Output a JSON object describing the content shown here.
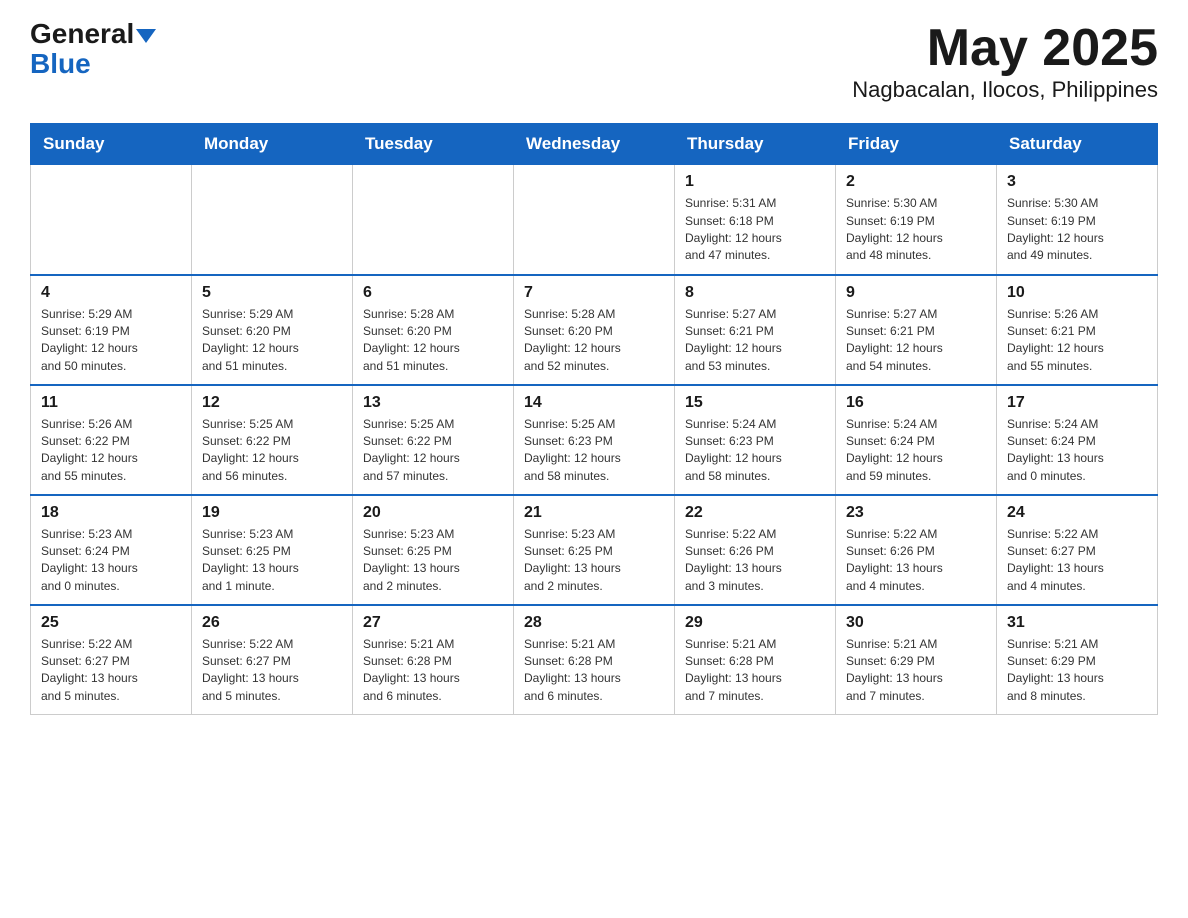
{
  "header": {
    "logo_general": "General",
    "logo_blue": "Blue",
    "month_title": "May 2025",
    "location": "Nagbacalan, Ilocos, Philippines"
  },
  "weekdays": [
    "Sunday",
    "Monday",
    "Tuesday",
    "Wednesday",
    "Thursday",
    "Friday",
    "Saturday"
  ],
  "weeks": [
    [
      {
        "day": "",
        "info": ""
      },
      {
        "day": "",
        "info": ""
      },
      {
        "day": "",
        "info": ""
      },
      {
        "day": "",
        "info": ""
      },
      {
        "day": "1",
        "info": "Sunrise: 5:31 AM\nSunset: 6:18 PM\nDaylight: 12 hours\nand 47 minutes."
      },
      {
        "day": "2",
        "info": "Sunrise: 5:30 AM\nSunset: 6:19 PM\nDaylight: 12 hours\nand 48 minutes."
      },
      {
        "day": "3",
        "info": "Sunrise: 5:30 AM\nSunset: 6:19 PM\nDaylight: 12 hours\nand 49 minutes."
      }
    ],
    [
      {
        "day": "4",
        "info": "Sunrise: 5:29 AM\nSunset: 6:19 PM\nDaylight: 12 hours\nand 50 minutes."
      },
      {
        "day": "5",
        "info": "Sunrise: 5:29 AM\nSunset: 6:20 PM\nDaylight: 12 hours\nand 51 minutes."
      },
      {
        "day": "6",
        "info": "Sunrise: 5:28 AM\nSunset: 6:20 PM\nDaylight: 12 hours\nand 51 minutes."
      },
      {
        "day": "7",
        "info": "Sunrise: 5:28 AM\nSunset: 6:20 PM\nDaylight: 12 hours\nand 52 minutes."
      },
      {
        "day": "8",
        "info": "Sunrise: 5:27 AM\nSunset: 6:21 PM\nDaylight: 12 hours\nand 53 minutes."
      },
      {
        "day": "9",
        "info": "Sunrise: 5:27 AM\nSunset: 6:21 PM\nDaylight: 12 hours\nand 54 minutes."
      },
      {
        "day": "10",
        "info": "Sunrise: 5:26 AM\nSunset: 6:21 PM\nDaylight: 12 hours\nand 55 minutes."
      }
    ],
    [
      {
        "day": "11",
        "info": "Sunrise: 5:26 AM\nSunset: 6:22 PM\nDaylight: 12 hours\nand 55 minutes."
      },
      {
        "day": "12",
        "info": "Sunrise: 5:25 AM\nSunset: 6:22 PM\nDaylight: 12 hours\nand 56 minutes."
      },
      {
        "day": "13",
        "info": "Sunrise: 5:25 AM\nSunset: 6:22 PM\nDaylight: 12 hours\nand 57 minutes."
      },
      {
        "day": "14",
        "info": "Sunrise: 5:25 AM\nSunset: 6:23 PM\nDaylight: 12 hours\nand 58 minutes."
      },
      {
        "day": "15",
        "info": "Sunrise: 5:24 AM\nSunset: 6:23 PM\nDaylight: 12 hours\nand 58 minutes."
      },
      {
        "day": "16",
        "info": "Sunrise: 5:24 AM\nSunset: 6:24 PM\nDaylight: 12 hours\nand 59 minutes."
      },
      {
        "day": "17",
        "info": "Sunrise: 5:24 AM\nSunset: 6:24 PM\nDaylight: 13 hours\nand 0 minutes."
      }
    ],
    [
      {
        "day": "18",
        "info": "Sunrise: 5:23 AM\nSunset: 6:24 PM\nDaylight: 13 hours\nand 0 minutes."
      },
      {
        "day": "19",
        "info": "Sunrise: 5:23 AM\nSunset: 6:25 PM\nDaylight: 13 hours\nand 1 minute."
      },
      {
        "day": "20",
        "info": "Sunrise: 5:23 AM\nSunset: 6:25 PM\nDaylight: 13 hours\nand 2 minutes."
      },
      {
        "day": "21",
        "info": "Sunrise: 5:23 AM\nSunset: 6:25 PM\nDaylight: 13 hours\nand 2 minutes."
      },
      {
        "day": "22",
        "info": "Sunrise: 5:22 AM\nSunset: 6:26 PM\nDaylight: 13 hours\nand 3 minutes."
      },
      {
        "day": "23",
        "info": "Sunrise: 5:22 AM\nSunset: 6:26 PM\nDaylight: 13 hours\nand 4 minutes."
      },
      {
        "day": "24",
        "info": "Sunrise: 5:22 AM\nSunset: 6:27 PM\nDaylight: 13 hours\nand 4 minutes."
      }
    ],
    [
      {
        "day": "25",
        "info": "Sunrise: 5:22 AM\nSunset: 6:27 PM\nDaylight: 13 hours\nand 5 minutes."
      },
      {
        "day": "26",
        "info": "Sunrise: 5:22 AM\nSunset: 6:27 PM\nDaylight: 13 hours\nand 5 minutes."
      },
      {
        "day": "27",
        "info": "Sunrise: 5:21 AM\nSunset: 6:28 PM\nDaylight: 13 hours\nand 6 minutes."
      },
      {
        "day": "28",
        "info": "Sunrise: 5:21 AM\nSunset: 6:28 PM\nDaylight: 13 hours\nand 6 minutes."
      },
      {
        "day": "29",
        "info": "Sunrise: 5:21 AM\nSunset: 6:28 PM\nDaylight: 13 hours\nand 7 minutes."
      },
      {
        "day": "30",
        "info": "Sunrise: 5:21 AM\nSunset: 6:29 PM\nDaylight: 13 hours\nand 7 minutes."
      },
      {
        "day": "31",
        "info": "Sunrise: 5:21 AM\nSunset: 6:29 PM\nDaylight: 13 hours\nand 8 minutes."
      }
    ]
  ]
}
